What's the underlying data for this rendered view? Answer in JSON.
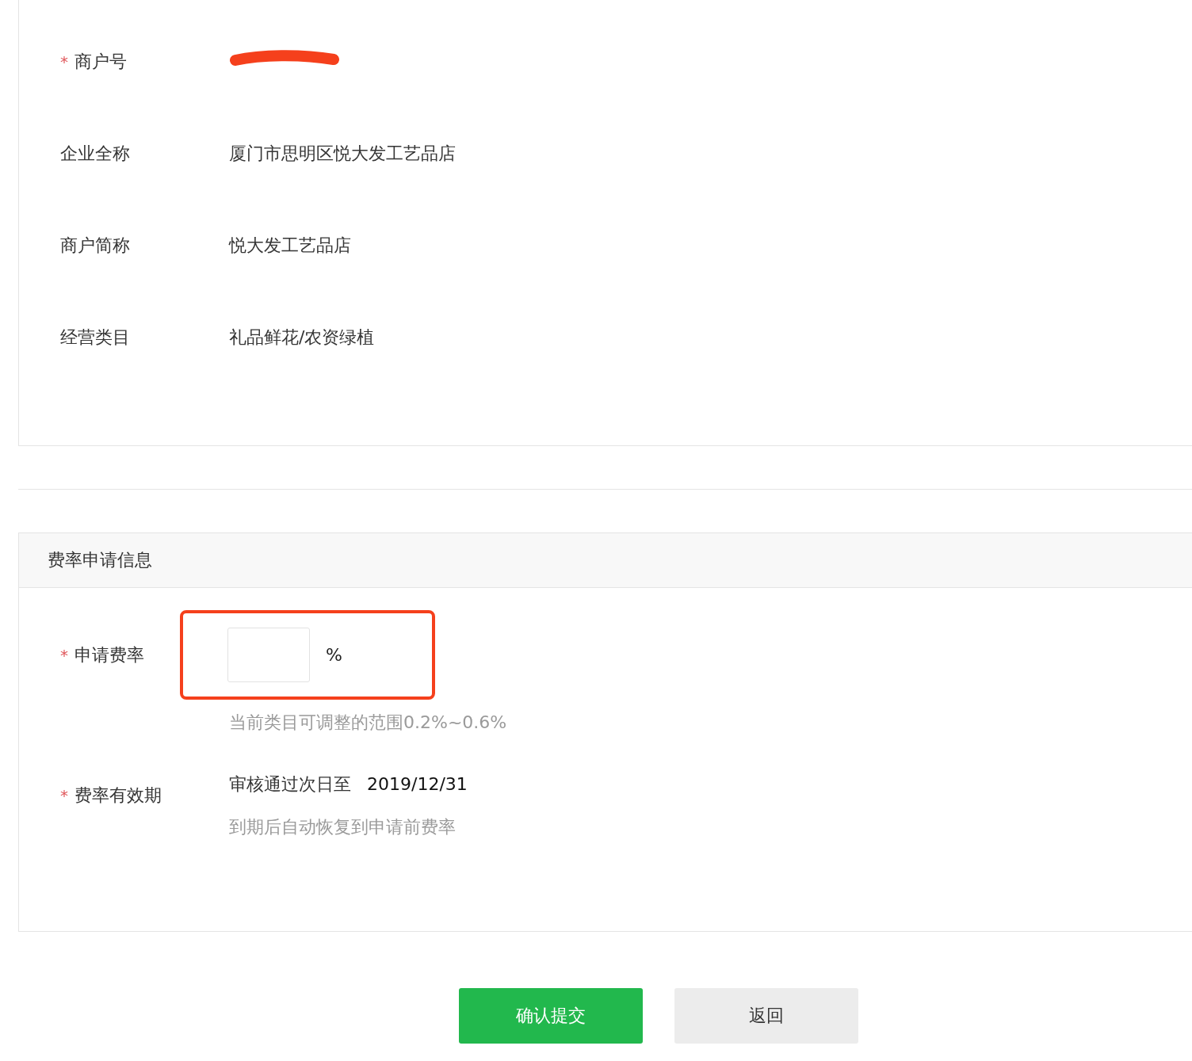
{
  "merchant_info": {
    "redacted_value": true,
    "rows": [
      {
        "label": "商户号",
        "mark": "*"
      },
      {
        "label": "企业全称",
        "value": "厦门市思明区悦大发工艺品店"
      },
      {
        "label": "商户简称",
        "value": "悦大发工艺品店"
      },
      {
        "label": "经营类目",
        "value": "礼品鲜花/农资绿植"
      }
    ]
  },
  "rate_application": {
    "title": "费率申请信息",
    "rate": {
      "label": "申请费率",
      "mark": "*",
      "unit": "%",
      "highlighted": true,
      "hint": "当前类目可调整的范围0.2%~0.6%"
    },
    "validity": {
      "label": "费率有效期",
      "mark": "*",
      "prefix": "审核通过次日至",
      "date": "2019/12/31",
      "hint": "到期后自动恢复到申请前费率"
    }
  },
  "buttons": [
    {
      "label": "确认提交",
      "kind": "primary"
    },
    {
      "label": "返回",
      "kind": "secondary"
    }
  ]
}
